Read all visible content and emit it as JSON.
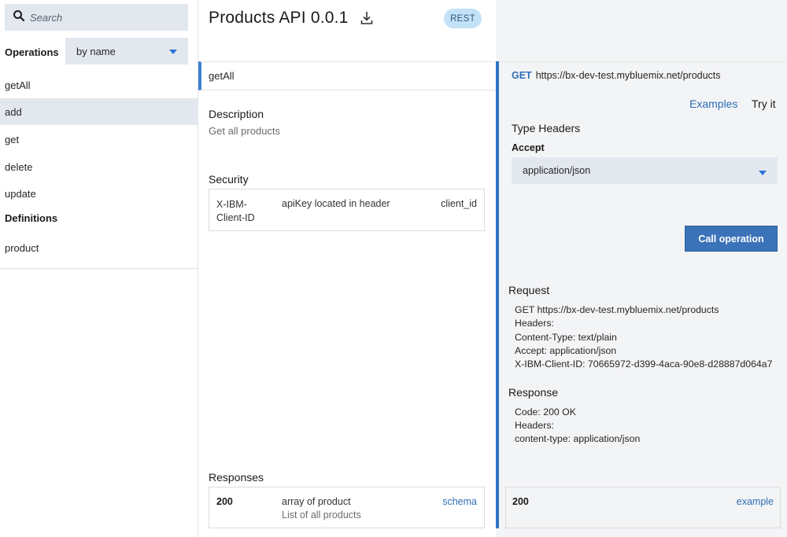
{
  "sidebar": {
    "search_placeholder": "Search",
    "operations_label": "Operations",
    "sort_value": "by name",
    "operations": [
      {
        "label": "getAll"
      },
      {
        "label": "add"
      },
      {
        "label": "get"
      },
      {
        "label": "delete"
      },
      {
        "label": "update"
      }
    ],
    "definitions_label": "Definitions",
    "definitions": [
      {
        "label": "product"
      }
    ]
  },
  "header": {
    "title": "Products API 0.0.1",
    "badge": "REST",
    "download_icon": "download-icon"
  },
  "operation": {
    "name": "getAll",
    "description_heading": "Description",
    "description": "Get all products",
    "security_heading": "Security",
    "security": {
      "name": "X-IBM-Client-ID",
      "location": "apiKey located in header",
      "param": "client_id"
    },
    "responses_heading": "Responses",
    "response": {
      "code": "200",
      "type": "array of product",
      "description": "List of all products",
      "schema_link": "schema"
    }
  },
  "try_panel": {
    "verb": "GET",
    "url": "https://bx-dev-test.mybluemix.net/products",
    "tabs": {
      "examples": "Examples",
      "try_it": "Try it"
    },
    "type_headers_label": "Type Headers",
    "accept_label": "Accept",
    "accept_value": "application/json",
    "call_button": "Call operation",
    "request_heading": "Request",
    "request_lines": [
      "GET https://bx-dev-test.mybluemix.net/products",
      "Headers:",
      "Content-Type: text/plain",
      "Accept: application/json",
      "X-IBM-Client-ID: 70665972-d399-4aca-90e8-d28887d064a7"
    ],
    "response_heading": "Response",
    "response_lines": [
      "Code: 200 OK",
      "Headers:",
      "content-type: application/json"
    ],
    "example_code": "200",
    "example_link": "example"
  },
  "colors": {
    "accent": "#2d6db5",
    "button": "#3b73b9",
    "badge_bg": "#c4e2f7",
    "selected_bg": "#e3e8ef"
  }
}
